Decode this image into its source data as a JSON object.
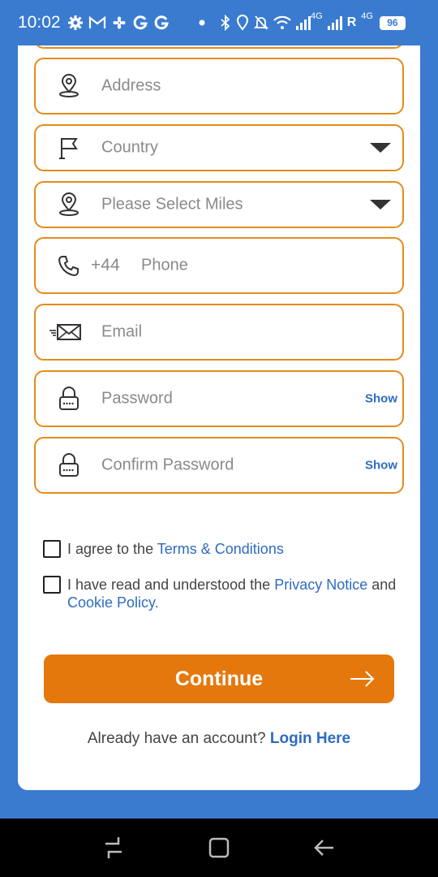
{
  "status_bar": {
    "time": "10:02",
    "network_4g_1": "4G",
    "roaming": "R",
    "network_4g_2": "4G",
    "battery": "96"
  },
  "form": {
    "address_placeholder": "Address",
    "country_placeholder": "Country",
    "miles_placeholder": "Please Select Miles",
    "phone_prefix": "+44",
    "phone_placeholder": "Phone",
    "email_placeholder": "Email",
    "password_placeholder": "Password",
    "password_show": "Show",
    "confirm_password_placeholder": "Confirm Password",
    "confirm_password_show": "Show"
  },
  "agreements": {
    "terms_prefix": "I agree to the ",
    "terms_link": "Terms & Conditions",
    "privacy_prefix": "I have read and understood the ",
    "privacy_link": "Privacy Notice",
    "privacy_and": " and",
    "cookie_link": "Cookie Policy",
    "cookie_suffix": "."
  },
  "actions": {
    "continue_label": "Continue",
    "login_prompt": "Already have an account? ",
    "login_link": "Login Here"
  },
  "colors": {
    "background": "#3a7bd0",
    "accent": "#e5780d",
    "border": "#e58b1a",
    "link": "#2d6cc0"
  }
}
